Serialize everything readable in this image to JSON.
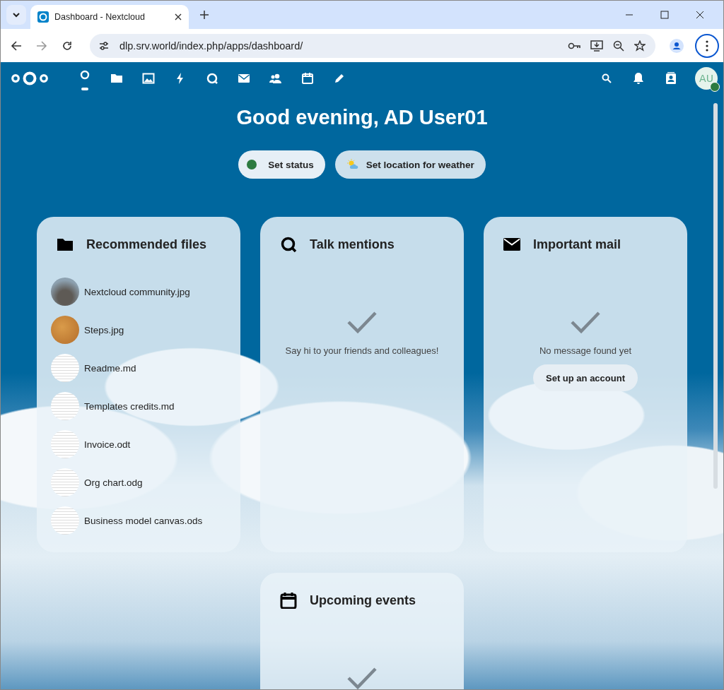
{
  "browser": {
    "tab_title": "Dashboard - Nextcloud",
    "url": "dlp.srv.world/index.php/apps/dashboard/"
  },
  "apps": [
    {
      "kind": "dashboard",
      "selected": true
    },
    {
      "kind": "files",
      "selected": false
    },
    {
      "kind": "photos",
      "selected": false
    },
    {
      "kind": "activity",
      "selected": false
    },
    {
      "kind": "talk",
      "selected": false
    },
    {
      "kind": "mail",
      "selected": false
    },
    {
      "kind": "contacts",
      "selected": false
    },
    {
      "kind": "calendar",
      "selected": false
    },
    {
      "kind": "notes",
      "selected": false
    }
  ],
  "avatar": {
    "initials": "AU",
    "online": true
  },
  "greeting": "Good evening, AD User01",
  "status_buttons": [
    {
      "kind": "status",
      "label": "Set status",
      "color": "#2d7b41"
    },
    {
      "kind": "weather",
      "label": "Set location for weather"
    }
  ],
  "widgets": [
    {
      "kind": "files",
      "title": "Recommended files",
      "items": [
        {
          "name": "Nextcloud community.jpg",
          "kind": "image"
        },
        {
          "name": "Steps.jpg",
          "kind": "image"
        },
        {
          "name": "Readme.md",
          "kind": "document"
        },
        {
          "name": "Templates credits.md",
          "kind": "document"
        },
        {
          "name": "Invoice.odt",
          "kind": "document"
        },
        {
          "name": "Org chart.odg",
          "kind": "document"
        },
        {
          "name": "Business model canvas.ods",
          "kind": "document"
        }
      ]
    },
    {
      "kind": "talk",
      "title": "Talk mentions",
      "empty_text": "Say hi to your friends and colleagues!"
    },
    {
      "kind": "mail",
      "title": "Important mail",
      "empty_text": "No message found yet",
      "button": "Set up an account"
    },
    {
      "kind": "calendar",
      "title": "Upcoming events"
    }
  ]
}
